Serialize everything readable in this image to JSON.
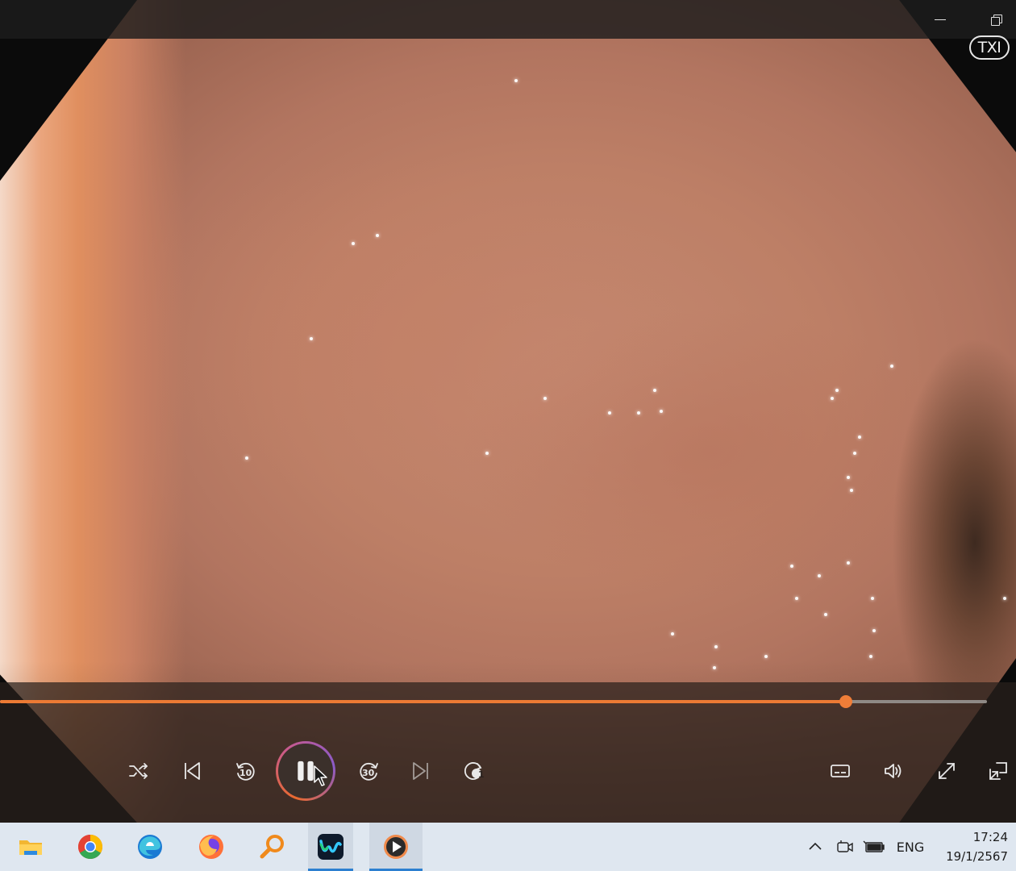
{
  "window": {
    "overlay_badge": "TXI",
    "controls": {
      "minimize": "minimize",
      "restore": "restore"
    }
  },
  "player": {
    "progress": 0.857,
    "skip_back_seconds": "10",
    "skip_forward_seconds": "30",
    "repeat_count": "1",
    "state": "playing",
    "accent_color": "#ec7a34"
  },
  "controls_left": [
    {
      "name": "shuffle-icon"
    },
    {
      "name": "previous-icon"
    },
    {
      "name": "skip-back-10-icon"
    },
    {
      "name": "pause-icon"
    },
    {
      "name": "skip-forward-30-icon"
    },
    {
      "name": "next-icon"
    },
    {
      "name": "repeat-one-icon"
    }
  ],
  "controls_right": [
    {
      "name": "subtitles-icon"
    },
    {
      "name": "volume-icon"
    },
    {
      "name": "fullscreen-icon"
    },
    {
      "name": "miniplayer-icon"
    }
  ],
  "taskbar": {
    "apps": [
      {
        "name": "file-explorer-icon",
        "active": false
      },
      {
        "name": "chrome-icon",
        "active": false
      },
      {
        "name": "edge-icon",
        "active": false
      },
      {
        "name": "firefox-icon",
        "active": false
      },
      {
        "name": "search-tool-icon",
        "active": false
      },
      {
        "name": "webex-icon",
        "active": true
      },
      {
        "name": "media-player-icon",
        "active": true
      }
    ],
    "tray": {
      "language": "ENG",
      "time": "17:24",
      "date": "19/1/2567"
    }
  }
}
